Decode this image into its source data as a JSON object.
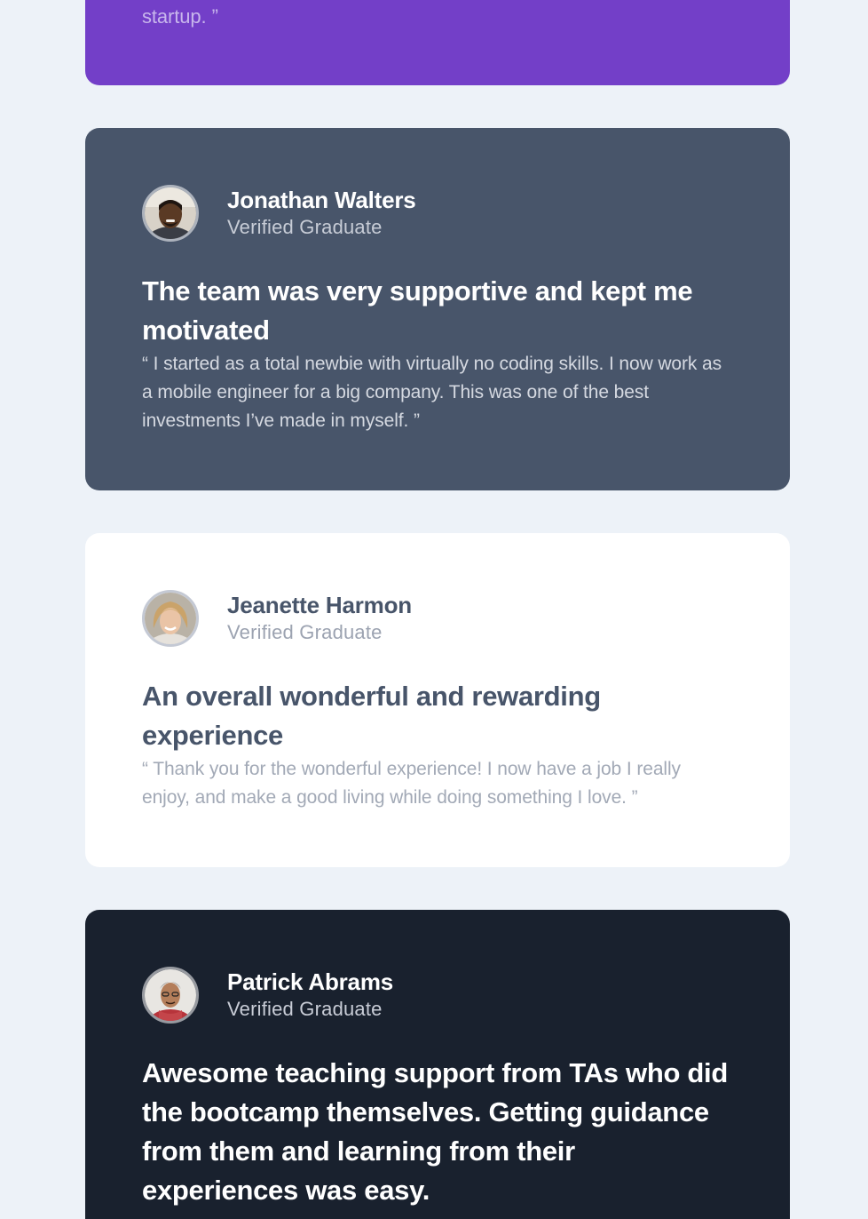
{
  "testimonials": [
    {
      "quote_tail": "startup. ”",
      "accent": "#733fc8"
    },
    {
      "name": "Jonathan Walters",
      "role": "Verified Graduate",
      "headline": "The team was very supportive and kept me motivated",
      "quote": "“ I started as a total newbie with virtually no coding skills. I now work as a mobile engineer for a big company. This was one of the best investments I’ve made in myself. ”",
      "accent": "#48556a"
    },
    {
      "name": "Jeanette Harmon",
      "role": "Verified Graduate",
      "headline": "An overall wonderful and rewarding experience",
      "quote": "“ Thank you for the wonderful experience! I now have a job I really enjoy, and make a good living while doing something I love. ”",
      "accent": "#ffffff"
    },
    {
      "name": "Patrick Abrams",
      "role": "Verified Graduate",
      "headline": "Awesome teaching support from TAs who did the bootcamp themselves. Getting guidance from them and learning from their experiences was easy.",
      "accent": "#19212e"
    }
  ]
}
